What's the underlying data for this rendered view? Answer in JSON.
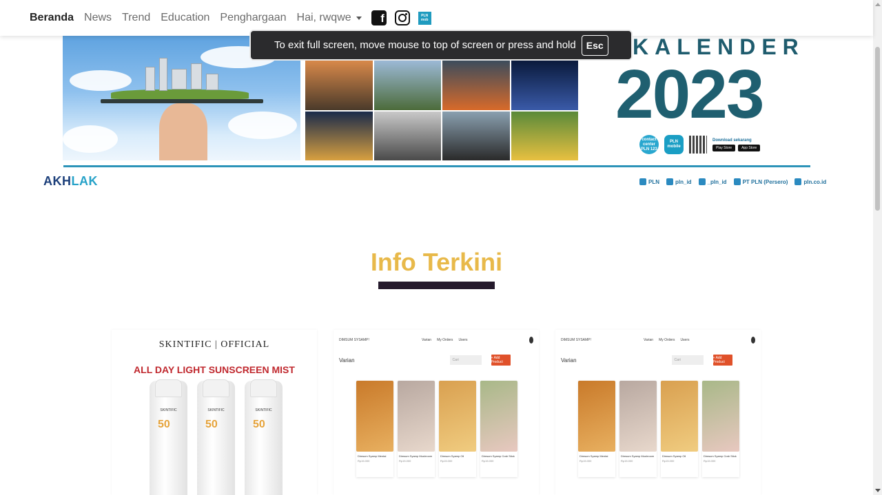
{
  "navbar": {
    "items": [
      {
        "label": "Beranda"
      },
      {
        "label": "News"
      },
      {
        "label": "Trend"
      },
      {
        "label": "Education"
      },
      {
        "label": "Penghargaan"
      }
    ],
    "user_greeting": "Hai, rwqwe",
    "social_icons": [
      "facebook-icon",
      "instagram-icon",
      "pln-mobile-icon"
    ]
  },
  "fullscreen_notice": {
    "message": "To exit full screen, move mouse to top of screen or press and hold",
    "key": "Esc"
  },
  "banner": {
    "title": "KALENDER",
    "year": "2023",
    "contact_center": "contact center PLN 123",
    "pln_mobile": "PLN mobile",
    "download_text": "Download sekarang",
    "store_1": "Play Store",
    "store_2": "App Store",
    "akhlak_dark": "AKH",
    "akhlak_light": "LAK",
    "social_handles": [
      "PLN",
      "pln_id",
      "_pln_id",
      "PT PLN (Persero)",
      "pln.co.id"
    ]
  },
  "section": {
    "title": "Info Terkini"
  },
  "cards": {
    "sk_brand": "SKINTIFIC  |  OFFICIAL",
    "sk_promo": "ALL DAY LIGHT SUNSCREEN MIST",
    "sk_bottle_text": "SKINTIFIC",
    "sk_spf": "50",
    "menu_site_logo": "DIMSUM SYSAMP!",
    "menu_nav": [
      "Varian",
      "My Orders",
      "Users"
    ],
    "menu_heading": "Varian",
    "menu_search_placeholder": "Cari",
    "menu_add_button": "+ Add Product",
    "foods": [
      {
        "name": "Dimsum Syamp Mentai",
        "price": "Rp15.000"
      },
      {
        "name": "Dimsum Syamp Mushroom",
        "price": "Rp15.000"
      },
      {
        "name": "Dimsum Syamp Oil",
        "price": "Rp15.000"
      },
      {
        "name": "Dimsum Syamp Crab Stick",
        "price": "Rp15.000"
      }
    ]
  },
  "colors": {
    "accent_yellow": "#e8b94a",
    "dark_bar": "#251a2c",
    "pln_teal": "#1f5f70",
    "promo_red": "#c0282e"
  }
}
